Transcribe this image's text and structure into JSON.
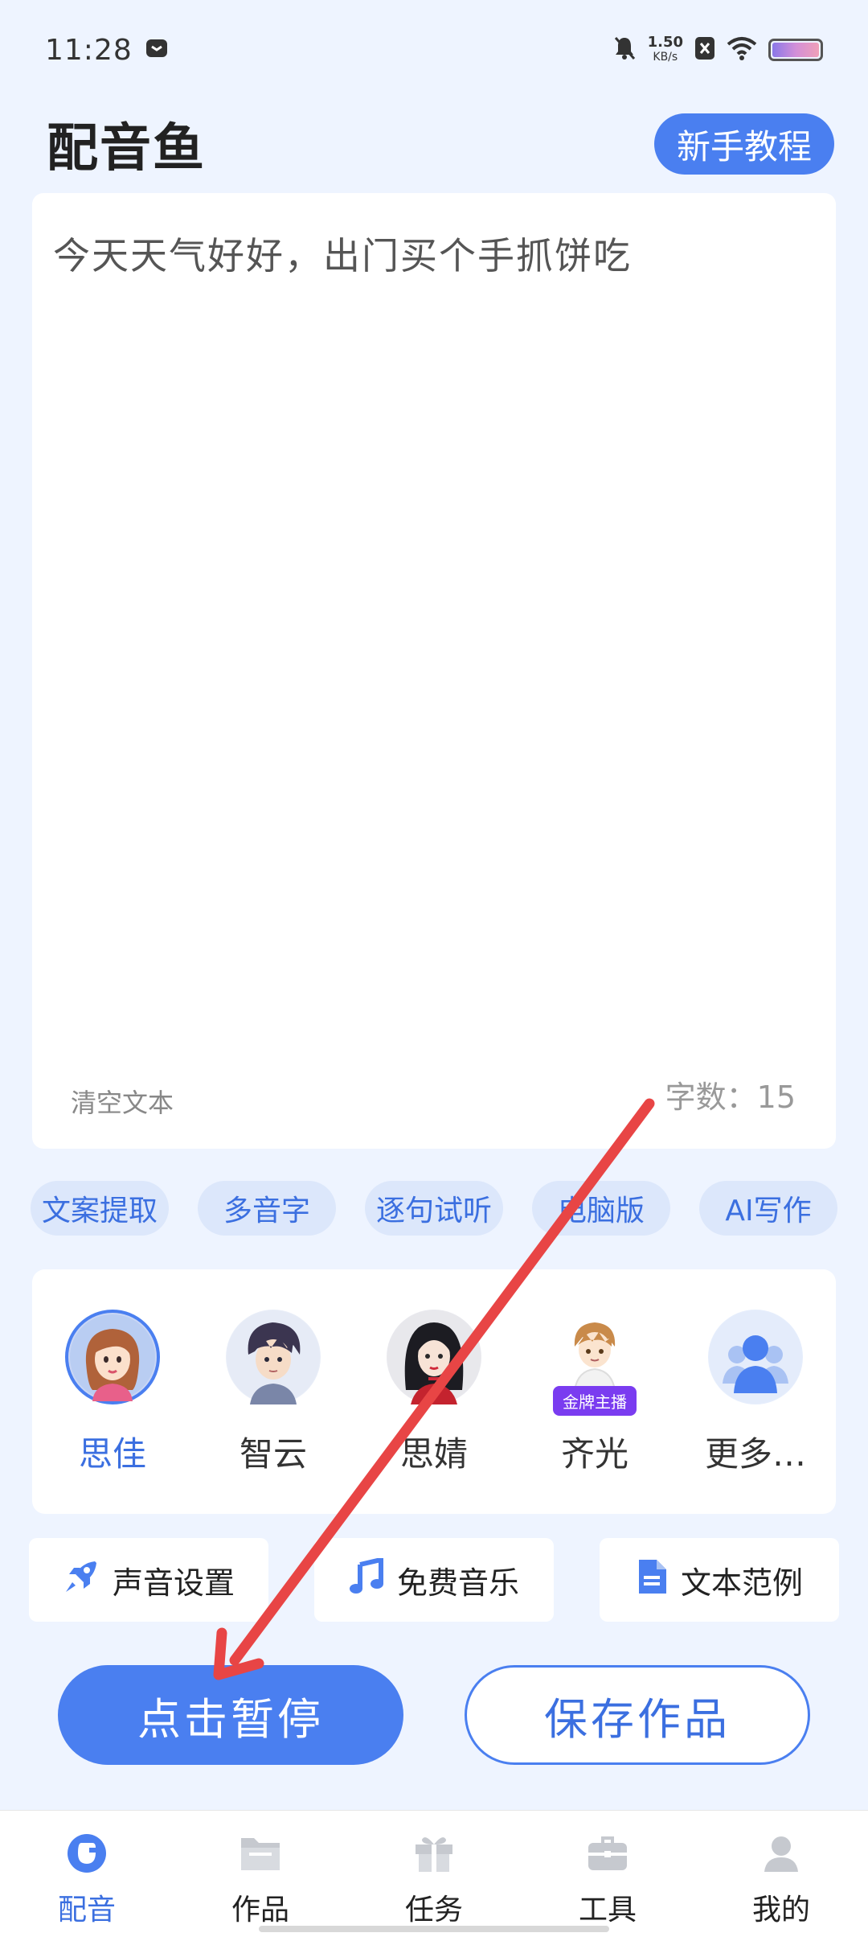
{
  "status_bar": {
    "time": "11:28",
    "net_speed_value": "1.50",
    "net_speed_unit": "KB/s",
    "icons": [
      "message-icon",
      "mute-icon",
      "close-box-icon",
      "wifi-icon",
      "battery-icon"
    ]
  },
  "header": {
    "title": "配音鱼",
    "tutorial_label": "新手教程"
  },
  "editor": {
    "text": "今天天气好好，出门买个手抓饼吃",
    "clear_label": "清空文本",
    "word_count": "字数：15"
  },
  "chips": [
    {
      "label": "文案提取"
    },
    {
      "label": "多音字"
    },
    {
      "label": "逐句试听"
    },
    {
      "label": "电脑版"
    },
    {
      "label": "AI写作"
    }
  ],
  "voices": {
    "items": [
      {
        "name": "思佳",
        "selected": true
      },
      {
        "name": "智云"
      },
      {
        "name": "思婧"
      },
      {
        "name": "齐光",
        "badge": "金牌主播"
      },
      {
        "name": "更多…"
      }
    ]
  },
  "options": [
    {
      "label": "声音设置",
      "icon": "rocket-icon"
    },
    {
      "label": "免费音乐",
      "icon": "music-note-icon"
    },
    {
      "label": "文本范例",
      "icon": "document-icon"
    }
  ],
  "actions": {
    "primary_label": "点击暂停",
    "secondary_label": "保存作品"
  },
  "bottom_nav": {
    "items": [
      {
        "label": "配音",
        "icon": "dubbing-icon",
        "active": true
      },
      {
        "label": "作品",
        "icon": "folder-icon"
      },
      {
        "label": "任务",
        "icon": "gift-icon"
      },
      {
        "label": "工具",
        "icon": "toolbox-icon"
      },
      {
        "label": "我的",
        "icon": "user-icon"
      }
    ]
  },
  "colors": {
    "accent": "#4a7ff0",
    "background": "#eef4ff",
    "annotation": "#e84545"
  }
}
